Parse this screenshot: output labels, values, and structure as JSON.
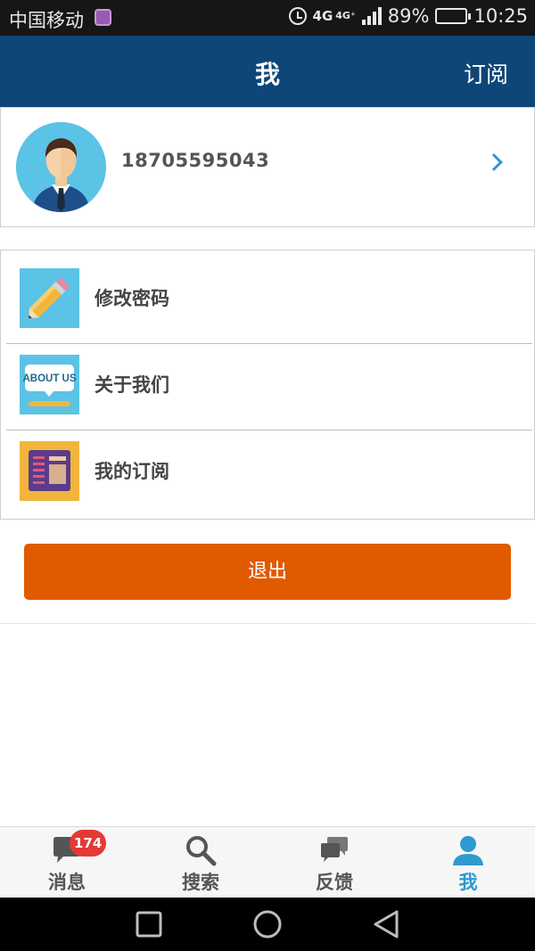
{
  "status_bar": {
    "carrier": "中国移动",
    "network": "4G",
    "network_secondary": "4G⁺",
    "battery": "89%",
    "battery_level": 0.89,
    "time": "10:25"
  },
  "header": {
    "title": "我",
    "subscribe_label": "订阅"
  },
  "profile": {
    "phone": "18705595043",
    "avatar_icon": "user-avatar-icon"
  },
  "menu": {
    "items": [
      {
        "label": "修改密码",
        "icon": "pencil-icon"
      },
      {
        "label": "关于我们",
        "icon": "about-us-icon",
        "icon_text": "ABOUT US"
      },
      {
        "label": "我的订阅",
        "icon": "subscription-icon"
      }
    ]
  },
  "logout": {
    "label": "退出"
  },
  "tabbar": {
    "tabs": [
      {
        "label": "消息",
        "icon": "message-icon",
        "badge": "174"
      },
      {
        "label": "搜索",
        "icon": "search-icon"
      },
      {
        "label": "反馈",
        "icon": "feedback-icon"
      },
      {
        "label": "我",
        "icon": "user-icon",
        "active": true
      }
    ]
  },
  "colors": {
    "header_bg": "#0e4677",
    "accent": "#2e9ad0",
    "logout_bg": "#e05a00",
    "badge_bg": "#e53935"
  }
}
